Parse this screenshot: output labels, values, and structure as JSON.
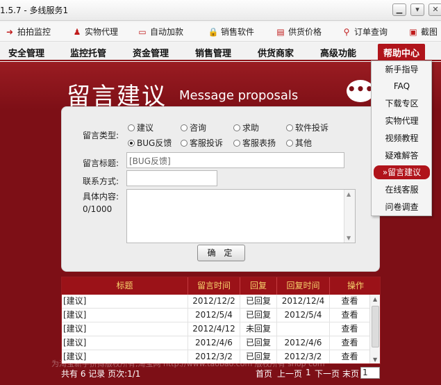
{
  "window": {
    "title": "1.5.7 - 多线服务1"
  },
  "toolbar": [
    {
      "label": "拍拍监控",
      "icon": "arrow-right-icon",
      "glyph": "➜",
      "color": "#c01b1b"
    },
    {
      "label": "实物代理",
      "icon": "people-icon",
      "glyph": "♟",
      "color": "#c01b1b"
    },
    {
      "label": "自动加款",
      "icon": "card-icon",
      "glyph": "▭",
      "color": "#c01b1b"
    },
    {
      "label": "销售软件",
      "icon": "lock-icon",
      "glyph": "🔒",
      "color": "#c01b1b"
    },
    {
      "label": "供货价格",
      "icon": "document-icon",
      "glyph": "▤",
      "color": "#c01b1b"
    },
    {
      "label": "订单查询",
      "icon": "search-icon",
      "glyph": "⚲",
      "color": "#c01b1b"
    },
    {
      "label": "截图",
      "icon": "picture-icon",
      "glyph": "▣",
      "color": "#c01b1b"
    }
  ],
  "menu": [
    {
      "label": "安全管理"
    },
    {
      "label": "监控托管"
    },
    {
      "label": "资金管理"
    },
    {
      "label": "销售管理"
    },
    {
      "label": "供货商家"
    },
    {
      "label": "高级功能"
    },
    {
      "label": "帮助中心"
    }
  ],
  "dropdown": [
    {
      "label": "新手指导"
    },
    {
      "label": "FAQ"
    },
    {
      "label": "下载专区"
    },
    {
      "label": "实物代理"
    },
    {
      "label": "视频教程"
    },
    {
      "label": "疑难解答"
    },
    {
      "label": "»留言建议"
    },
    {
      "label": "在线客服"
    },
    {
      "label": "问卷调查"
    }
  ],
  "page": {
    "title_cn": "留言建议",
    "title_en": "Message proposals",
    "chat_glyph": "•••"
  },
  "form": {
    "type_label": "留言类型:",
    "types": [
      {
        "label": "建议",
        "checked": false
      },
      {
        "label": "咨询",
        "checked": false
      },
      {
        "label": "求助",
        "checked": false
      },
      {
        "label": "软件投诉",
        "checked": false
      },
      {
        "label": "BUG反馈",
        "checked": true
      },
      {
        "label": "客服投诉",
        "checked": false
      },
      {
        "label": "客服表扬",
        "checked": false
      },
      {
        "label": "其他",
        "checked": false
      }
    ],
    "subject_label": "留言标题:",
    "subject_value": "[BUG反馈]",
    "contact_label": "联系方式:",
    "contact_value": "",
    "content_label": "具体内容:",
    "content_counter": "0/1000",
    "content_value": "",
    "submit_label": "确 定"
  },
  "table": {
    "columns": [
      "标题",
      "留言时间",
      "回复",
      "回复时间",
      "操作"
    ],
    "rows": [
      [
        "[建议]",
        "2012/12/2",
        "已回复",
        "2012/12/4",
        "查看"
      ],
      [
        "[建议]",
        "2012/5/4",
        "已回复",
        "2012/5/4",
        "查看"
      ],
      [
        "[建议]",
        "2012/4/12",
        "未回复",
        "",
        "查看"
      ],
      [
        "[建议]",
        "2012/4/6",
        "已回复",
        "2012/4/6",
        "查看"
      ],
      [
        "[建议]",
        "2012/3/2",
        "已回复",
        "2012/3/2",
        "查看"
      ]
    ]
  },
  "watermark": "为淘宝新手拼搏版权所有,淘宝网 http://www.taobao.com  版权所有  shop  com",
  "footer": {
    "summary": "共有 6 记录 页次:1/1",
    "first": "首页",
    "prev": "上一页",
    "current": "1",
    "next": "下一页",
    "last": "末页",
    "page_input": "1"
  }
}
